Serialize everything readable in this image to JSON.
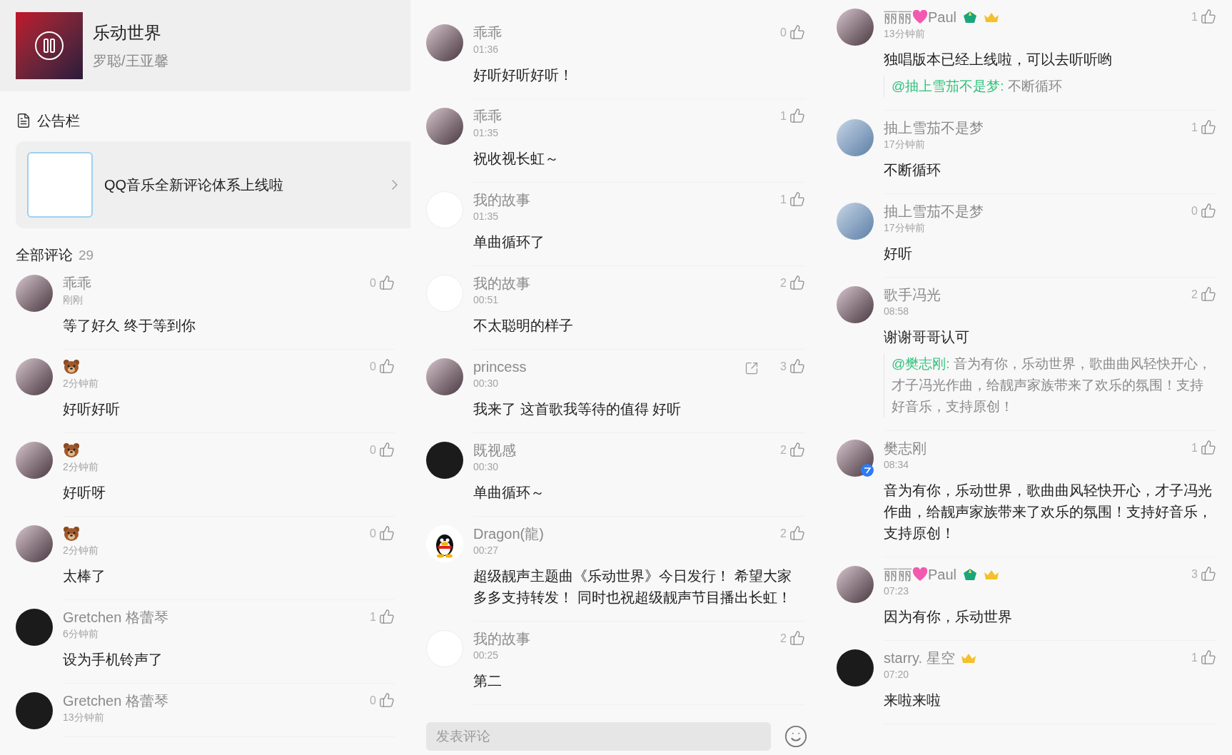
{
  "song": {
    "title": "乐动世界",
    "artist": "罗聪/王亚馨",
    "playing": true
  },
  "notice": {
    "heading": "公告栏",
    "text": "QQ音乐全新评论体系上线啦"
  },
  "all_comments": {
    "label": "全部评论",
    "count": "29"
  },
  "columns": [
    {
      "comments": [
        {
          "kind": "photo",
          "name_parts": [
            {
              "kind": "text",
              "text": "乖乖"
            }
          ],
          "time": "刚刚",
          "likes": "0",
          "content": "等了好久 终于等到你"
        },
        {
          "kind": "photo",
          "name_parts": [
            {
              "kind": "bear"
            }
          ],
          "time": "2分钟前",
          "likes": "0",
          "content": "好听好听"
        },
        {
          "kind": "photo",
          "name_parts": [
            {
              "kind": "bear"
            }
          ],
          "time": "2分钟前",
          "likes": "0",
          "content": "好听呀"
        },
        {
          "kind": "photo",
          "name_parts": [
            {
              "kind": "bear"
            }
          ],
          "time": "2分钟前",
          "likes": "0",
          "content": "太棒了"
        },
        {
          "kind": "dark",
          "name_parts": [
            {
              "kind": "text",
              "text": "Gretchen 格蕾琴"
            }
          ],
          "time": "6分钟前",
          "likes": "1",
          "content": "设为手机铃声了"
        },
        {
          "kind": "dark",
          "name_parts": [
            {
              "kind": "text",
              "text": "Gretchen 格蕾琴"
            }
          ],
          "time": "13分钟前",
          "likes": "0"
        }
      ]
    },
    {
      "comments": [
        {
          "kind": "photo",
          "name_parts": [
            {
              "kind": "text",
              "text": "乖乖"
            }
          ],
          "time": "01:36",
          "likes": "0",
          "content": "好听好听好听！"
        },
        {
          "kind": "photo",
          "name_parts": [
            {
              "kind": "text",
              "text": "乖乖"
            }
          ],
          "time": "01:35",
          "likes": "1",
          "content": "祝收视长虹～"
        },
        {
          "kind": "light",
          "name_parts": [
            {
              "kind": "text",
              "text": "我的故事"
            }
          ],
          "time": "01:35",
          "likes": "1",
          "content": "单曲循环了"
        },
        {
          "kind": "light",
          "name_parts": [
            {
              "kind": "text",
              "text": "我的故事"
            }
          ],
          "time": "00:51",
          "likes": "2",
          "content": "不太聪明的样子"
        },
        {
          "kind": "photo",
          "name_parts": [
            {
              "kind": "text",
              "text": "princess"
            }
          ],
          "time": "00:30",
          "likes": "3",
          "share": true,
          "content": "我来了 这首歌我等待的值得 好听"
        },
        {
          "kind": "dark",
          "name_parts": [
            {
              "kind": "text",
              "text": "既视感"
            }
          ],
          "time": "00:30",
          "likes": "2",
          "content": "单曲循环～"
        },
        {
          "kind": "penguin",
          "name_parts": [
            {
              "kind": "text",
              "text": "Dragon(龍)"
            }
          ],
          "time": "00:27",
          "likes": "2",
          "content": "超级靓声主题曲《乐动世界》今日发行！ 希望大家多多支持转发！ 同时也祝超级靓声节目播出长虹！"
        },
        {
          "kind": "light",
          "name_parts": [
            {
              "kind": "text",
              "text": "我的故事"
            }
          ],
          "time": "00:25",
          "likes": "2",
          "content": "第二"
        }
      ]
    },
    {
      "comments": [
        {
          "kind": "photo",
          "name_parts": [
            {
              "kind": "text",
              "text": "丽丽"
            },
            {
              "kind": "heart"
            },
            {
              "kind": "text",
              "text": "Paul"
            },
            {
              "kind": "level"
            },
            {
              "kind": "crown"
            }
          ],
          "time": "13分钟前",
          "likes": "1",
          "content": "独唱版本已经上线啦，可以去听听哟",
          "reply": {
            "mention": "@抽上雪茄不是梦:",
            "text": "不断循环"
          }
        },
        {
          "kind": "sky",
          "name_parts": [
            {
              "kind": "text",
              "text": "抽上雪茄不是梦"
            }
          ],
          "time": "17分钟前",
          "likes": "1",
          "content": "不断循环"
        },
        {
          "kind": "sky",
          "name_parts": [
            {
              "kind": "text",
              "text": "抽上雪茄不是梦"
            }
          ],
          "time": "17分钟前",
          "likes": "0",
          "content": "好听"
        },
        {
          "kind": "photo",
          "name_parts": [
            {
              "kind": "text",
              "text": "歌手冯光"
            }
          ],
          "time": "08:58",
          "likes": "2",
          "content": "谢谢哥哥认可",
          "reply": {
            "mention": "@樊志刚:",
            "text": "音为有你，乐动世界，歌曲曲风轻快开心，才子冯光作曲，给靓声家族带来了欢乐的氛围！支持好音乐，支持原创！"
          }
        },
        {
          "kind": "photo",
          "verified": true,
          "name_parts": [
            {
              "kind": "text",
              "text": "樊志刚"
            }
          ],
          "time": "08:34",
          "likes": "1",
          "content": "音为有你，乐动世界，歌曲曲风轻快开心，才子冯光作曲，给靓声家族带来了欢乐的氛围！支持好音乐，支持原创！"
        },
        {
          "kind": "photo",
          "name_parts": [
            {
              "kind": "text",
              "text": "丽丽"
            },
            {
              "kind": "heart"
            },
            {
              "kind": "text",
              "text": "Paul"
            },
            {
              "kind": "level"
            },
            {
              "kind": "crown"
            }
          ],
          "time": "07:23",
          "likes": "3",
          "content": "因为有你，乐动世界"
        },
        {
          "kind": "dark",
          "name_parts": [
            {
              "kind": "text",
              "text": "starry. 星空"
            },
            {
              "kind": "crown"
            }
          ],
          "time": "07:20",
          "likes": "1",
          "content": "来啦来啦"
        }
      ]
    }
  ],
  "comment_box": {
    "placeholder": "发表评论"
  }
}
